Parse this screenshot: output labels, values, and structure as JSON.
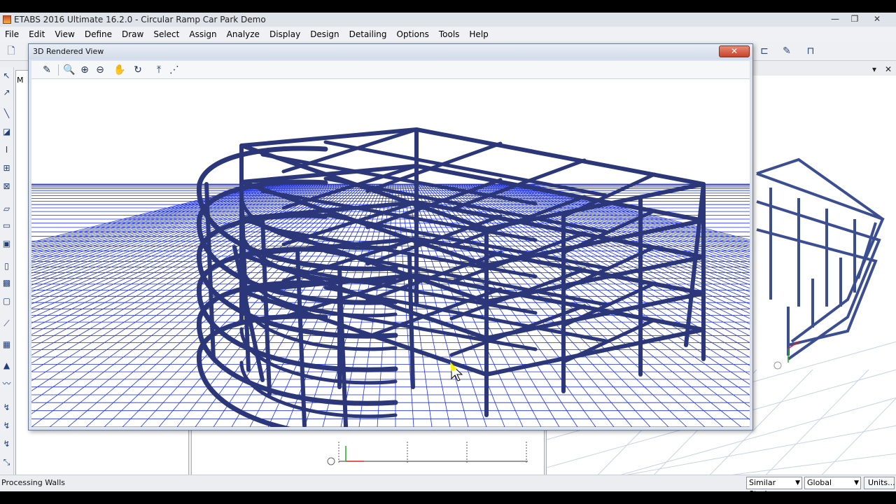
{
  "window": {
    "title": "ETABS 2016 Ultimate 16.2.0 - Circular Ramp Car Park Demo",
    "minimize_glyph": "—",
    "restore_glyph": "❐",
    "close_glyph": "✕"
  },
  "menu": {
    "items": [
      "File",
      "Edit",
      "View",
      "Define",
      "Draw",
      "Select",
      "Assign",
      "Analyze",
      "Display",
      "Design",
      "Detailing",
      "Options",
      "Tools",
      "Help"
    ]
  },
  "dialog": {
    "title": "3D Rendered View",
    "close_glyph": "✕",
    "toolbar_icons": [
      "pencil-icon",
      "zoom-window-icon",
      "zoom-in-icon",
      "zoom-out-icon",
      "pan-icon",
      "rotate-icon",
      "move-vertical-icon",
      "view-options-icon"
    ]
  },
  "explorer": {
    "tab_label": "M"
  },
  "status": {
    "text": "Processing Walls",
    "stories_select": "Similar Stories",
    "coord_select": "Global",
    "units_button": "Units..."
  },
  "colors": {
    "frame": "#2b3778",
    "grid": "#1a2fe0",
    "dialog_close": "#c6432a"
  }
}
